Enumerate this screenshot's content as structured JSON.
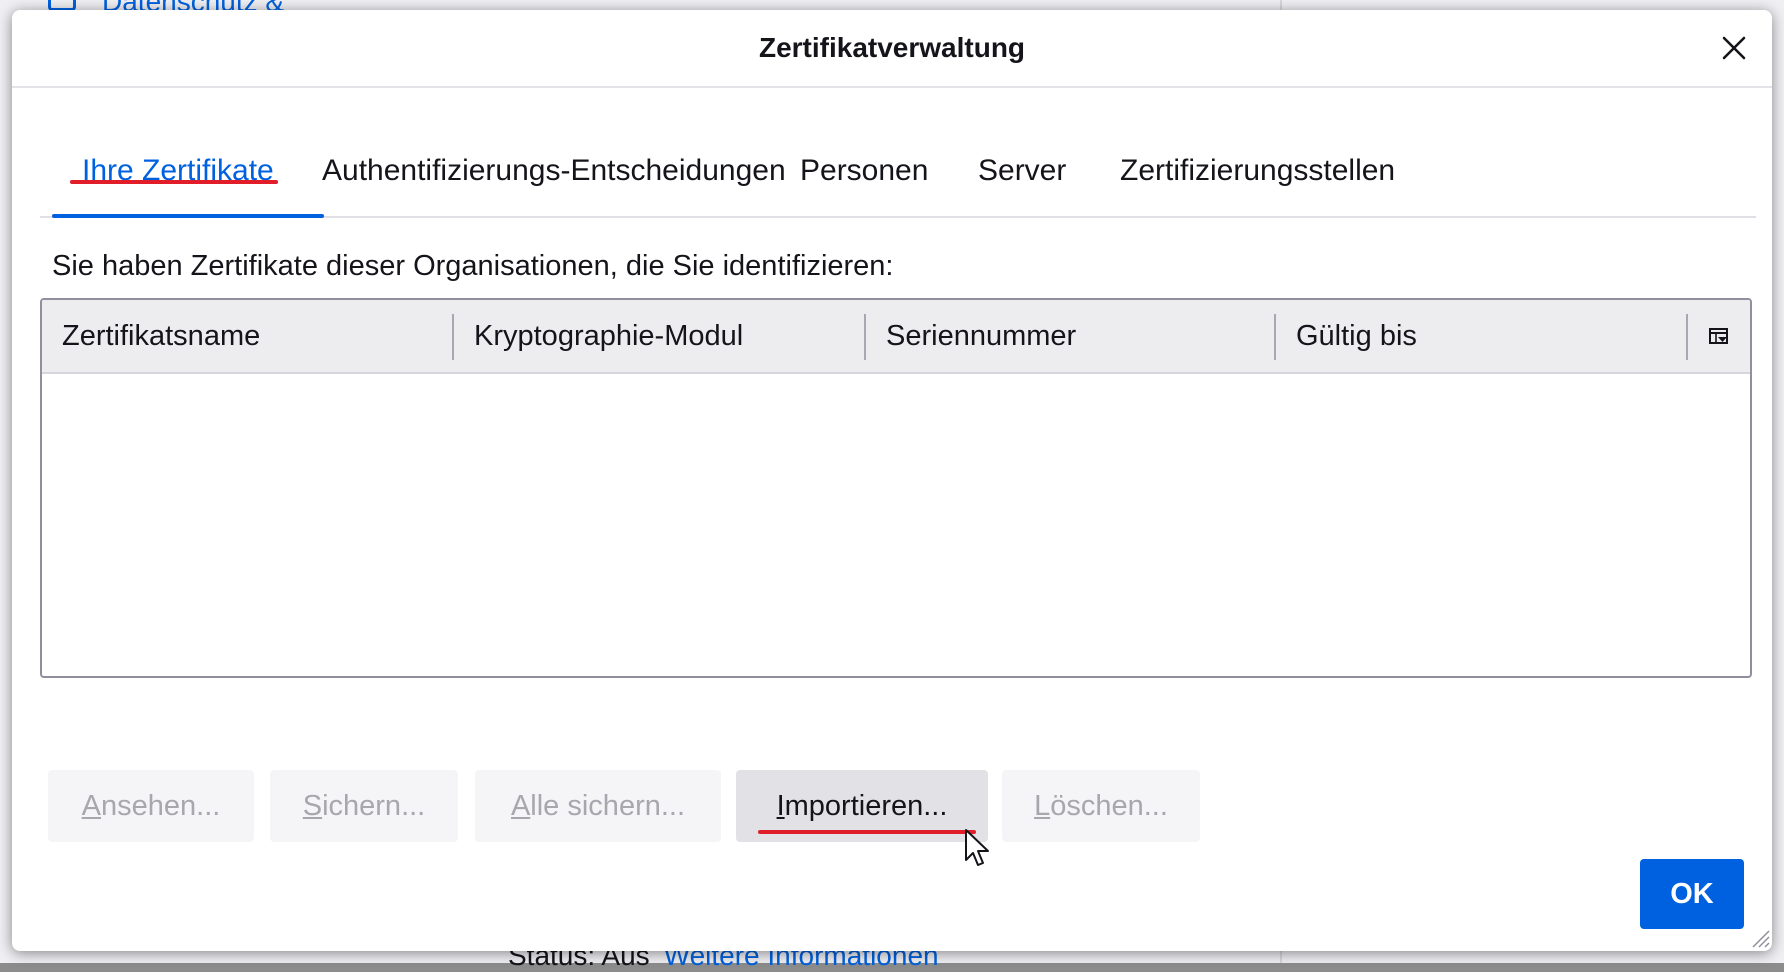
{
  "background": {
    "top_link": "Datenschutz &",
    "bottom_status": "Status: Aus",
    "bottom_link": "Weitere Informationen"
  },
  "dialog": {
    "title": "Zertifikatverwaltung",
    "close_icon": "close-icon"
  },
  "tabs": [
    {
      "label": "Ihre Zertifikate",
      "active": true
    },
    {
      "label": "Authentifizierungs-Entscheidungen",
      "active": false
    },
    {
      "label": "Personen",
      "active": false
    },
    {
      "label": "Server",
      "active": false
    },
    {
      "label": "Zertifizierungsstellen",
      "active": false
    }
  ],
  "description": "Sie haben Zertifikate dieser Organisationen, die Sie identifizieren:",
  "table": {
    "columns": [
      "Zertifikatsname",
      "Kryptographie-Modul",
      "Seriennummer",
      "Gültig bis"
    ],
    "column_picker_icon": "column-picker-icon",
    "rows": []
  },
  "buttons": {
    "view": {
      "accel": "A",
      "rest": "nsehen...",
      "enabled": false
    },
    "backup": {
      "accel": "S",
      "rest": "ichern...",
      "enabled": false
    },
    "backup_all": {
      "accel": "A",
      "rest": "lle sichern...",
      "enabled": false
    },
    "import": {
      "accel": "I",
      "rest": "mportieren...",
      "enabled": true
    },
    "delete": {
      "accel": "L",
      "rest": "öschen...",
      "enabled": false
    }
  },
  "ok_label": "OK",
  "colors": {
    "accent": "#0061e0",
    "highlight_marker": "#e21d2a"
  }
}
